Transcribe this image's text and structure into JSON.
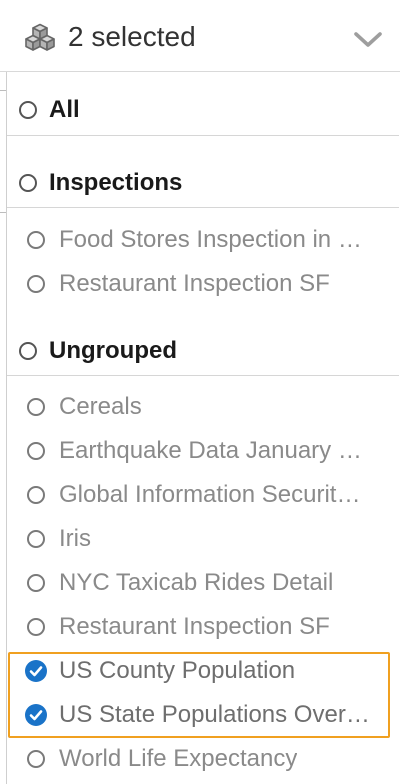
{
  "header": {
    "summary": "2 selected",
    "dataset_icon": "dataset-cubes-icon",
    "toggle_icon": "chevron-down-icon"
  },
  "options": {
    "all": {
      "label": "All"
    },
    "groups": [
      {
        "label": "Inspections",
        "items": [
          {
            "label": "Food Stores Inspection in …",
            "selected": false
          },
          {
            "label": "Restaurant Inspection SF",
            "selected": false
          }
        ]
      },
      {
        "label": "Ungrouped",
        "items": [
          {
            "label": "Cereals",
            "selected": false
          },
          {
            "label": "Earthquake Data January …",
            "selected": false
          },
          {
            "label": "Global Information Securit…",
            "selected": false
          },
          {
            "label": "Iris",
            "selected": false
          },
          {
            "label": "NYC Taxicab Rides Detail",
            "selected": false
          },
          {
            "label": "Restaurant Inspection SF",
            "selected": false
          },
          {
            "label": "US County Population",
            "selected": true
          },
          {
            "label": "US State Populations Over…",
            "selected": true
          },
          {
            "label": "World Life Expectancy",
            "selected": false
          }
        ]
      }
    ]
  },
  "colors": {
    "checked": "#1a73c8",
    "highlight": "#f0a020"
  }
}
